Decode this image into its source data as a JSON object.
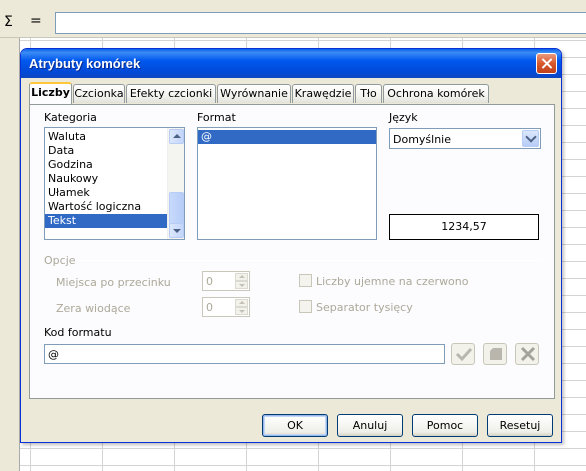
{
  "formula_bar": {
    "sigma": "Σ",
    "equals": "="
  },
  "dialog": {
    "title": "Atrybuty komórek",
    "tabs": [
      "Liczby",
      "Czcionka",
      "Efekty czcionki",
      "Wyrównanie",
      "Krawędzie",
      "Tło",
      "Ochrona komórek"
    ],
    "active_tab": "Liczby",
    "category": {
      "label": "Kategoria",
      "items": [
        "Waluta",
        "Data",
        "Godzina",
        "Naukowy",
        "Ułamek",
        "Wartość logiczna",
        "Tekst"
      ],
      "selected": "Tekst"
    },
    "format": {
      "label": "Format",
      "items": [
        "@"
      ],
      "selected": "@"
    },
    "language": {
      "label": "Język",
      "value": "Domyślnie"
    },
    "preview": {
      "value": "1234,57"
    },
    "options": {
      "label": "Opcje",
      "decimal_places_label": "Miejsca po przecinku",
      "decimal_places_value": "0",
      "leading_zeros_label": "Zera wiodące",
      "leading_zeros_value": "0",
      "negative_red_label": "Liczby ujemne na czerwono",
      "thousands_sep_label": "Separator tysięcy"
    },
    "format_code": {
      "label": "Kod formatu",
      "value": "@"
    },
    "buttons": {
      "ok": "OK",
      "cancel": "Anuluj",
      "help": "Pomoc",
      "reset": "Resetuj"
    }
  },
  "colors": {
    "title_bar": "#0058ee",
    "selection": "#316ac5",
    "dialog_bg": "#ece9d8"
  },
  "icons": [
    "close-icon",
    "checkmark-icon",
    "comment-icon",
    "delete-icon",
    "scroll-up-icon",
    "scroll-down-icon",
    "dropdown-arrow-icon"
  ]
}
